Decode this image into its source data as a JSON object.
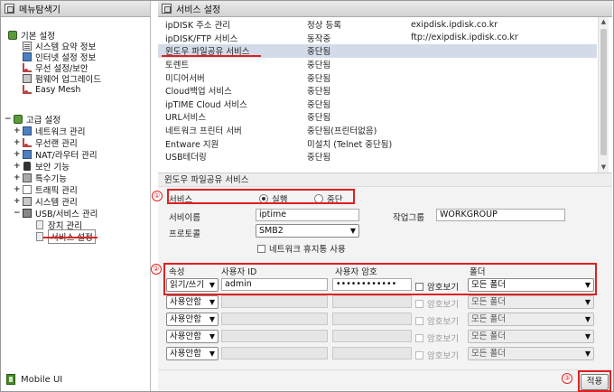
{
  "left_panel": {
    "title": "메뉴탐색기",
    "groups": [
      {
        "label": "기본 설정",
        "toggle": "",
        "items": [
          "시스템 요약 정보",
          "인터넷 설정 정보",
          "무선 설정/보안",
          "펌웨어 업그레이드",
          "Easy Mesh"
        ]
      },
      {
        "label": "고급 설정",
        "toggle": "−",
        "items": [
          "네트워크 관리",
          "무선랜 관리",
          "NAT/라우터 관리",
          "보안 기능",
          "특수기능",
          "트래픽 관리",
          "시스템 관리",
          "USB/서비스 관리"
        ]
      }
    ],
    "usb_children": [
      "장치 관리",
      "서비스 설정"
    ],
    "plus": "+",
    "minus": "−",
    "mobile_ui": "Mobile UI"
  },
  "right_panel": {
    "title": "서비스 설정",
    "services": [
      {
        "name": "ipDISK 주소 관리",
        "status": "정상 등록",
        "info": "exipdisk.ipdisk.co.kr"
      },
      {
        "name": "ipDISK/FTP 서비스",
        "status": "동작중",
        "info": "ftp://exipdisk.ipdisk.co.kr"
      },
      {
        "name": "윈도우 파일공유 서비스",
        "status": "중단됨",
        "info": ""
      },
      {
        "name": "토렌트",
        "status": "중단됨",
        "info": ""
      },
      {
        "name": "미디어서버",
        "status": "중단됨",
        "info": ""
      },
      {
        "name": "Cloud백업 서비스",
        "status": "중단됨",
        "info": ""
      },
      {
        "name": "ipTIME Cloud 서비스",
        "status": "중단됨",
        "info": ""
      },
      {
        "name": "URL서비스",
        "status": "중단됨",
        "info": ""
      },
      {
        "name": "네트워크 프린터 서버",
        "status": "중단됨(프린터없음)",
        "info": ""
      },
      {
        "name": "Entware 지원",
        "status": "미설치 (Telnet 중단됨)",
        "info": ""
      },
      {
        "name": "USB테더링",
        "status": "중단됨",
        "info": ""
      }
    ],
    "selected_index": 2,
    "section_title": "윈도우 파일공유 서비스",
    "form": {
      "service_label": "서비스",
      "run_label": "실행",
      "stop_label": "중단",
      "name_label": "서비이름",
      "name_value": "iptime",
      "workgroup_label": "작업그룹",
      "workgroup_value": "WORKGROUP",
      "protocol_label": "프로토콜",
      "protocol_value": "SMB2",
      "recycle_label": "네트워크 휴지통 사용"
    },
    "accounts": {
      "headers": {
        "attr": "속성",
        "user": "사용자 ID",
        "password": "사용자 암호",
        "folder": "폴더"
      },
      "show_password_label": "암호보기",
      "rows": [
        {
          "attr": "읽기/쓰기",
          "user": "admin",
          "password": "••••••••••••",
          "folder": "모든 폴더",
          "enabled": true
        },
        {
          "attr": "사용안함",
          "user": "",
          "password": "",
          "folder": "모든 폴더",
          "enabled": false
        },
        {
          "attr": "사용안함",
          "user": "",
          "password": "",
          "folder": "모든 폴더",
          "enabled": false
        },
        {
          "attr": "사용안함",
          "user": "",
          "password": "",
          "folder": "모든 폴더",
          "enabled": false
        },
        {
          "attr": "사용안함",
          "user": "",
          "password": "",
          "folder": "모든 폴더",
          "enabled": false
        }
      ]
    },
    "apply_label": "적용",
    "markers": [
      "①",
      "②",
      "③"
    ],
    "scroll_up": "▲",
    "scroll_down": "▼"
  },
  "colors": {
    "annotation": "#e02020",
    "selected_row": "#d4dbe8",
    "form_bg": "#f3f3f3"
  }
}
